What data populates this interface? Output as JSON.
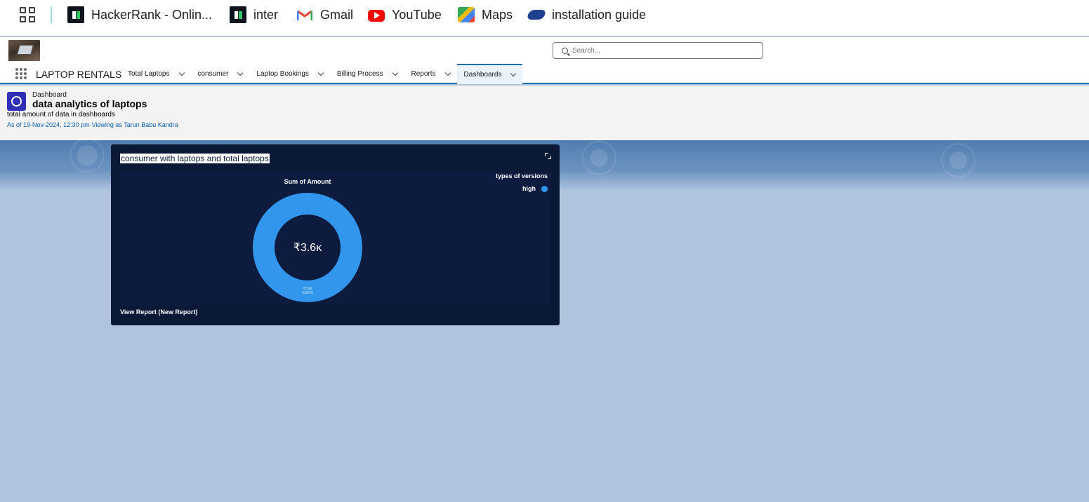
{
  "bookmarks": {
    "apps_icon": "apps-grid-icon",
    "items": [
      {
        "label": "HackerRank - Onlin...",
        "icon": "hackerrank-icon"
      },
      {
        "label": "inter",
        "icon": "hackerrank-icon"
      },
      {
        "label": "Gmail",
        "icon": "gmail-icon"
      },
      {
        "label": "YouTube",
        "icon": "youtube-icon"
      },
      {
        "label": "Maps",
        "icon": "maps-icon"
      },
      {
        "label": "installation guide",
        "icon": "link-icon"
      }
    ]
  },
  "header": {
    "search_placeholder": "Search...",
    "app_name": "LAPTOP RENTALS",
    "nav": [
      {
        "label": "Total Laptops",
        "active": false
      },
      {
        "label": "consumer",
        "active": false
      },
      {
        "label": "Laptop Bookings",
        "active": false
      },
      {
        "label": "Billing Process",
        "active": false
      },
      {
        "label": "Reports",
        "active": false
      },
      {
        "label": "Dashboards",
        "active": true
      }
    ]
  },
  "dashboard": {
    "type_label": "Dashboard",
    "title": "data analytics of laptops",
    "description": "total amount of data in dashboards",
    "meta": "As of 19-Nov-2024, 12:30 pm·Viewing as Tarun Babu Kandra"
  },
  "widget": {
    "title": "consumer with laptops and total laptops",
    "view_report": "View Report (New Report)",
    "accent": "#3296ed"
  },
  "chart_data": {
    "type": "pie",
    "subtype": "donut",
    "title": "Sum of Amount",
    "center_label": "₹3.6ĸ",
    "legend_title": "types of versions",
    "legend_placement": "top-right",
    "slices": [
      {
        "name": "high",
        "value": 3600,
        "percent": 100,
        "label": "₹3.6k",
        "sublabel": "(100%)",
        "color": "#3296ed"
      }
    ]
  }
}
